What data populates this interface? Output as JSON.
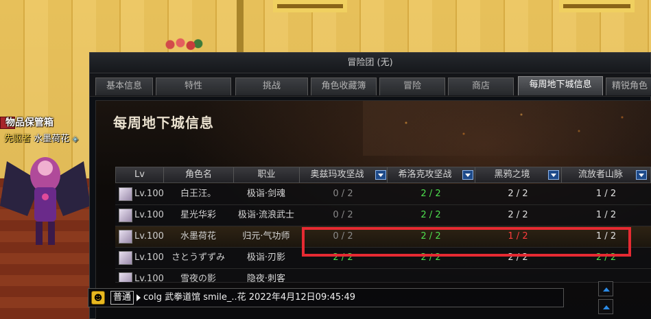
{
  "world": {
    "vault_label": "物品保管箱",
    "char_title": "先驱者",
    "char_name": "水墨荷花"
  },
  "window": {
    "title": "冒险团 (无)",
    "tabs": [
      {
        "label": "基本信息",
        "active": false
      },
      {
        "label": "特性",
        "active": false
      },
      {
        "label": "挑战",
        "active": false
      },
      {
        "label": "角色收藏簿",
        "active": false
      },
      {
        "label": "冒险",
        "active": false
      },
      {
        "label": "商店",
        "active": false
      },
      {
        "label": "每周地下城信息",
        "active": true
      },
      {
        "label": "精锐角色",
        "active": false
      }
    ],
    "panel_title": "每周地下城信息"
  },
  "table": {
    "headers": [
      "Lv",
      "角色名",
      "职业",
      "奥兹玛攻坚战",
      "希洛克攻坚战",
      "黑鸦之境",
      "流放者山脉"
    ],
    "rows": [
      {
        "lv": "Lv.100",
        "name": "白王汪。",
        "job": "极诣·剑魂",
        "ozma": "0 / 2",
        "sirocco": "2 / 2",
        "raven": "2 / 2",
        "exile": "1 / 2",
        "selected": false
      },
      {
        "lv": "Lv.100",
        "name": "星光华彩",
        "job": "极诣·流浪武士",
        "ozma": "0 / 2",
        "sirocco": "2 / 2",
        "raven": "2 / 2",
        "exile": "1 / 2",
        "selected": false
      },
      {
        "lv": "Lv.100",
        "name": "水墨荷花",
        "job": "归元·气功师",
        "ozma": "0 / 2",
        "sirocco": "2 / 2",
        "raven": "1 / 2",
        "exile": "1 / 2",
        "selected": true
      },
      {
        "lv": "Lv.100",
        "name": "さとうずずみ",
        "job": "极诣·刃影",
        "ozma": "2 / 2",
        "sirocco": "2 / 2",
        "raven": "2 / 2",
        "exile": "2 / 2",
        "selected": false
      },
      {
        "lv": "Lv.100",
        "name": "雪夜の影",
        "job": "隐夜·刺客",
        "ozma": "",
        "sirocco": "",
        "raven": "",
        "exile": "",
        "selected": false
      }
    ]
  },
  "chat": {
    "channel": "普通",
    "message": "colg 武拳道馆 smile_..花 2022年4月12日09:45:49"
  },
  "colors": {
    "complete": "#4ee04e",
    "partial": "#e0e0e0",
    "incomplete": "#8a8a8a",
    "alert": "#ff3c3c",
    "highlight_box": "#e62a32"
  }
}
